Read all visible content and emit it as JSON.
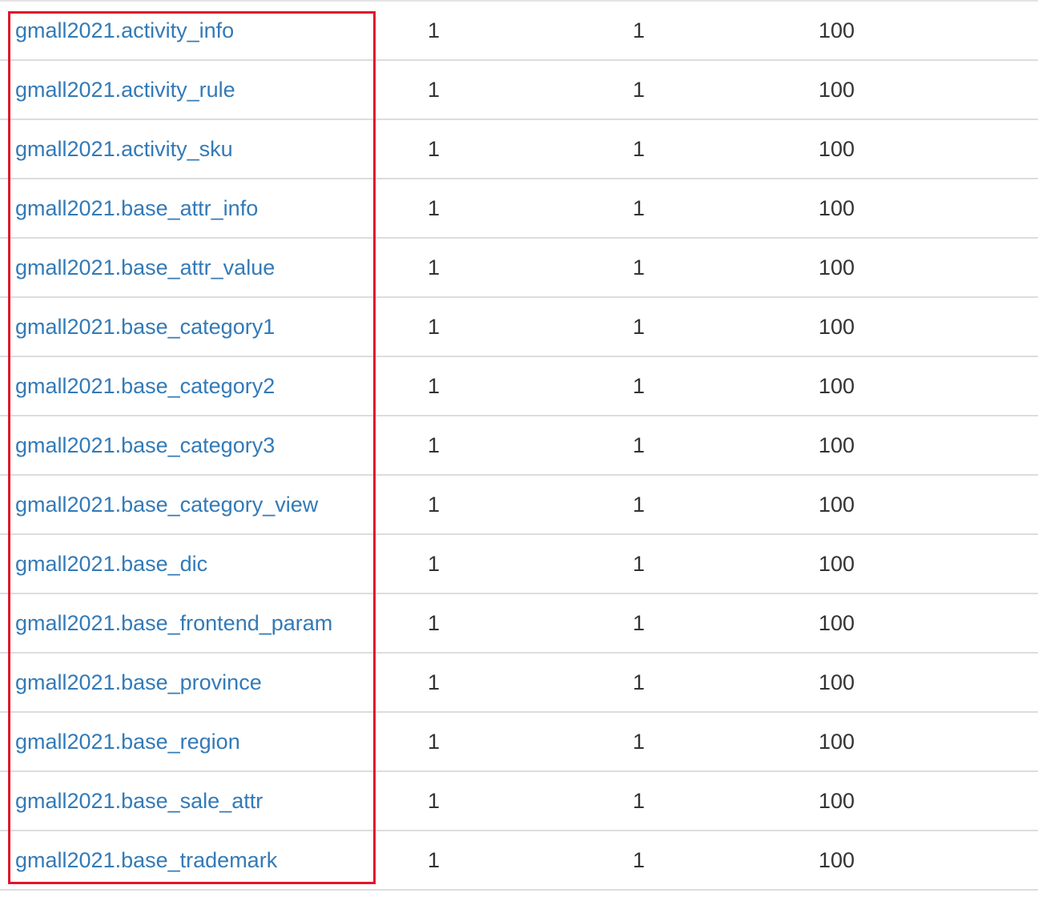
{
  "table": {
    "rows": [
      {
        "name": "gmall2021.activity_info",
        "col2": "1",
        "col3": "1",
        "col4": "100"
      },
      {
        "name": "gmall2021.activity_rule",
        "col2": "1",
        "col3": "1",
        "col4": "100"
      },
      {
        "name": "gmall2021.activity_sku",
        "col2": "1",
        "col3": "1",
        "col4": "100"
      },
      {
        "name": "gmall2021.base_attr_info",
        "col2": "1",
        "col3": "1",
        "col4": "100"
      },
      {
        "name": "gmall2021.base_attr_value",
        "col2": "1",
        "col3": "1",
        "col4": "100"
      },
      {
        "name": "gmall2021.base_category1",
        "col2": "1",
        "col3": "1",
        "col4": "100"
      },
      {
        "name": "gmall2021.base_category2",
        "col2": "1",
        "col3": "1",
        "col4": "100"
      },
      {
        "name": "gmall2021.base_category3",
        "col2": "1",
        "col3": "1",
        "col4": "100"
      },
      {
        "name": "gmall2021.base_category_view",
        "col2": "1",
        "col3": "1",
        "col4": "100"
      },
      {
        "name": "gmall2021.base_dic",
        "col2": "1",
        "col3": "1",
        "col4": "100"
      },
      {
        "name": "gmall2021.base_frontend_param",
        "col2": "1",
        "col3": "1",
        "col4": "100"
      },
      {
        "name": "gmall2021.base_province",
        "col2": "1",
        "col3": "1",
        "col4": "100"
      },
      {
        "name": "gmall2021.base_region",
        "col2": "1",
        "col3": "1",
        "col4": "100"
      },
      {
        "name": "gmall2021.base_sale_attr",
        "col2": "1",
        "col3": "1",
        "col4": "100"
      },
      {
        "name": "gmall2021.base_trademark",
        "col2": "1",
        "col3": "1",
        "col4": "100"
      }
    ]
  },
  "colors": {
    "link": "#337ab7",
    "text": "#333333",
    "highlight_border": "#e0162b",
    "row_border": "#dddddd"
  }
}
